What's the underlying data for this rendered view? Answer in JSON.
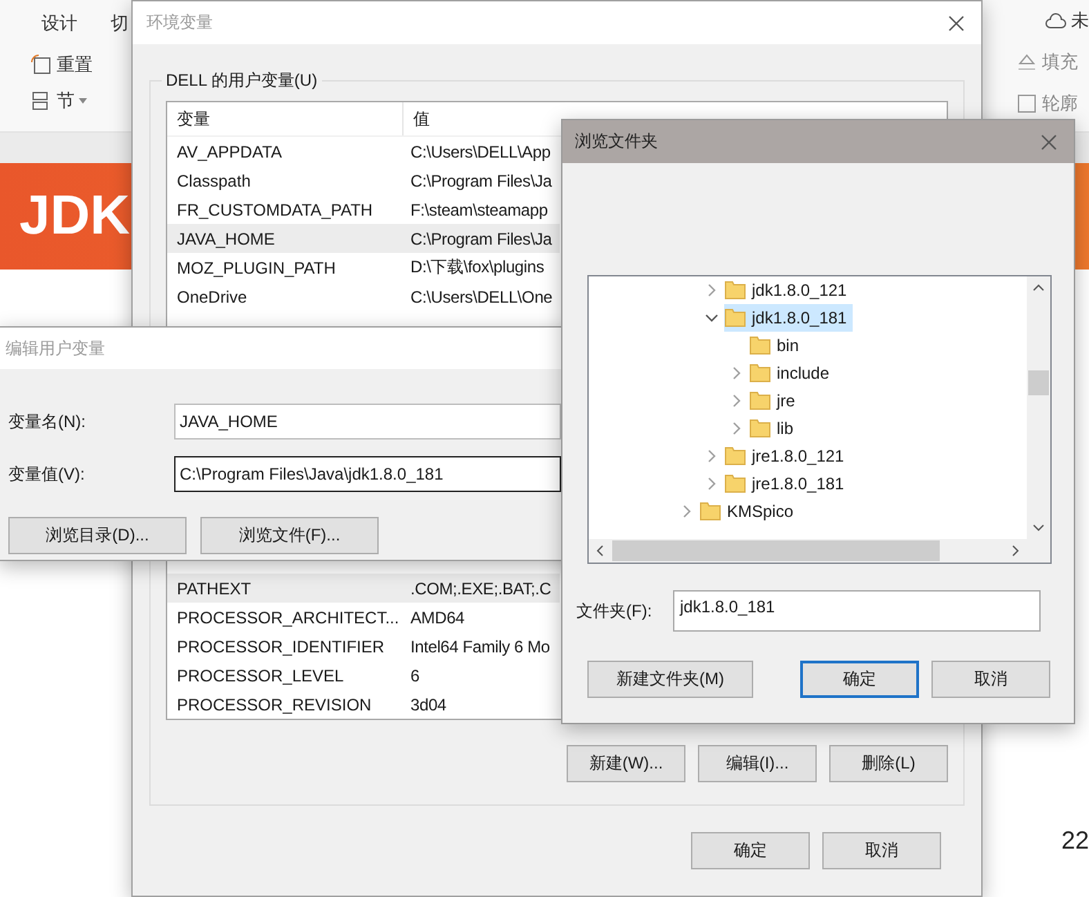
{
  "background_app": {
    "ribbon_tabs": [
      "设计",
      "切"
    ],
    "ribbon_tools": [
      {
        "label": "重置",
        "kind": "reset"
      },
      {
        "label": "节",
        "kind": "section"
      }
    ],
    "cloud_status": "未",
    "ribbon_right_tools": [
      {
        "label": "填充",
        "kind": "fill"
      },
      {
        "label": "轮廓",
        "kind": "outline"
      }
    ],
    "slide": {
      "banner_title": "JDK",
      "page_number": "22"
    }
  },
  "env_dialog": {
    "title": "环境变量",
    "user_group_label": "DELL 的用户变量(U)",
    "columns": [
      "变量",
      "值"
    ],
    "user_rows": [
      {
        "name": "AV_APPDATA",
        "value": "C:\\Users\\DELL\\App",
        "selected": false
      },
      {
        "name": "Classpath",
        "value": "C:\\Program Files\\Ja",
        "selected": false
      },
      {
        "name": "FR_CUSTOMDATA_PATH",
        "value": "F:\\steam\\steamapp",
        "selected": false
      },
      {
        "name": "JAVA_HOME",
        "value": "C:\\Program Files\\Ja",
        "selected": true
      },
      {
        "name": "MOZ_PLUGIN_PATH",
        "value": "D:\\下载\\fox\\plugins",
        "selected": false
      },
      {
        "name": "OneDrive",
        "value": "C:\\Users\\DELL\\One",
        "selected": false
      }
    ],
    "system_rows": [
      {
        "name": "PATHEXT",
        "value": ".COM;.EXE;.BAT;.C",
        "selected": true
      },
      {
        "name": "PROCESSOR_ARCHITECT...",
        "value": "AMD64",
        "selected": false
      },
      {
        "name": "PROCESSOR_IDENTIFIER",
        "value": "Intel64 Family 6 Mo",
        "selected": false
      },
      {
        "name": "PROCESSOR_LEVEL",
        "value": "6",
        "selected": false
      },
      {
        "name": "PROCESSOR_REVISION",
        "value": "3d04",
        "selected": false
      }
    ],
    "system_buttons": [
      "新建(W)...",
      "编辑(I)...",
      "删除(L)"
    ],
    "buttons": [
      "确定",
      "取消"
    ]
  },
  "edit_dialog": {
    "title": "编辑用户变量",
    "fields": [
      {
        "label": "变量名(N):",
        "value": "JAVA_HOME",
        "focused": false
      },
      {
        "label": "变量值(V):",
        "value": "C:\\Program Files\\Java\\jdk1.8.0_181",
        "focused": true
      }
    ],
    "buttons": [
      "浏览目录(D)...",
      "浏览文件(F)..."
    ]
  },
  "browse_dialog": {
    "title": "浏览文件夹",
    "tree": {
      "scrolled_branch": [
        {
          "label": "jdk1.8.0_121",
          "kind": "branch",
          "expanded": false,
          "selected": false
        },
        {
          "label": "jdk1.8.0_181",
          "kind": "branch",
          "expanded": true,
          "selected": true,
          "children": [
            {
              "label": "bin",
              "kind": "leaf",
              "selected": false
            },
            {
              "label": "include",
              "kind": "branch",
              "expanded": false,
              "selected": false
            },
            {
              "label": "jre",
              "kind": "branch",
              "expanded": false,
              "selected": false
            },
            {
              "label": "lib",
              "kind": "branch",
              "expanded": false,
              "selected": false
            }
          ]
        },
        {
          "label": "jre1.8.0_121",
          "kind": "branch",
          "expanded": false,
          "selected": false
        },
        {
          "label": "jre1.8.0_181",
          "kind": "branch",
          "expanded": false,
          "selected": false
        }
      ],
      "items": [
        {
          "label": "KMSpico",
          "kind": "branch",
          "expanded": false,
          "selected": false
        }
      ]
    },
    "folder_label": "文件夹(F):",
    "folder_value": "jdk1.8.0_181",
    "buttons": [
      {
        "label": "新建文件夹(M)",
        "default": false
      },
      {
        "label": "确定",
        "default": true
      },
      {
        "label": "取消",
        "default": false
      }
    ]
  }
}
